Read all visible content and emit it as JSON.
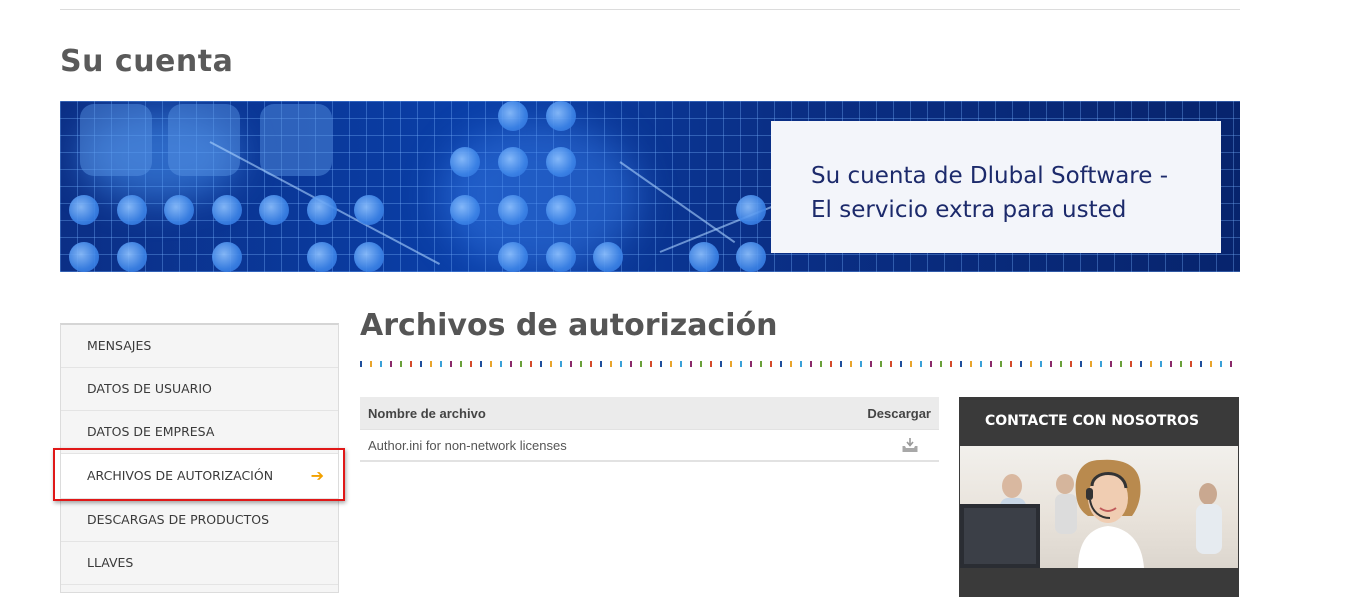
{
  "page": {
    "title": "Su cuenta"
  },
  "banner": {
    "line1": "Su cuenta de Dlubal Software -",
    "line2": "El servicio extra para usted"
  },
  "sidebar": {
    "items": [
      {
        "label": "MENSAJES"
      },
      {
        "label": "DATOS DE USUARIO"
      },
      {
        "label": "DATOS DE EMPRESA"
      },
      {
        "label": "ARCHIVOS DE AUTORIZACIÓN",
        "active": true,
        "arrow": "➔"
      },
      {
        "label": "DESCARGAS DE PRODUCTOS"
      },
      {
        "label": "LLAVES"
      }
    ]
  },
  "main": {
    "title": "Archivos de autorización",
    "table": {
      "headers": {
        "name": "Nombre de archivo",
        "download": "Descargar"
      },
      "rows": [
        {
          "name": "Author.ini for non-network licenses",
          "icon": "download-icon"
        }
      ]
    }
  },
  "contact": {
    "title": "CONTACTE CON NOSOTROS"
  },
  "colors": {
    "highlight": "#e01818",
    "arrow": "#f2a100",
    "banner_text": "#1c2a6b"
  }
}
